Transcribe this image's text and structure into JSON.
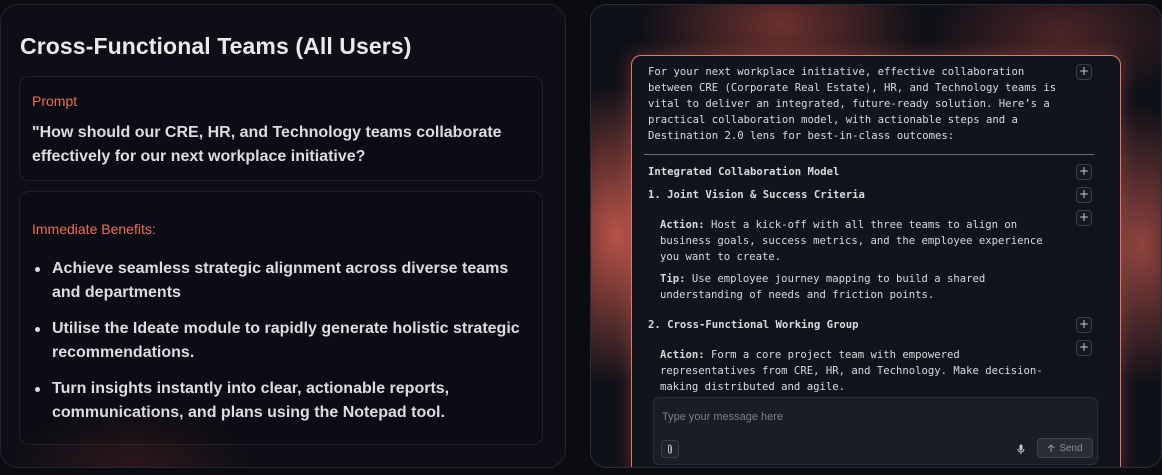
{
  "page": {
    "title": "Cross-Functional Teams (All Users)"
  },
  "prompt_card": {
    "label": "Prompt",
    "text": "\"How should our CRE, HR, and Technology teams collaborate effectively for our next workplace initiative?"
  },
  "benefits_card": {
    "label": "Immediate Benefits:",
    "items": [
      "Achieve seamless strategic alignment across diverse teams and departments",
      "Utilise the Ideate module to rapidly generate holistic strategic recommendations.",
      "Turn insights instantly into clear, actionable reports, communications, and plans using the Notepad tool."
    ]
  },
  "chat": {
    "intro": "For your next workplace initiative, effective collaboration between CRE (Corporate Real Estate), HR, and Technology teams is vital to deliver an integrated, future-ready solution. Here’s a practical collaboration model, with actionable steps and a Destination 2.0 lens for best-in-class outcomes:",
    "section_title": "Integrated Collaboration Model",
    "step1_title": "1. Joint Vision & Success Criteria",
    "step1_action_label": "Action:",
    "step1_action_text": " Host a kick-off with all three teams to align on business goals, success metrics, and the employee experience you want to create.",
    "step1_tip_label": "Tip:",
    "step1_tip_text": " Use employee journey mapping to build a shared understanding of needs and friction points.",
    "step2_title": "2. Cross-Functional Working Group",
    "step2_action_label": "Action:",
    "step2_action_text": " Form a core project team with empowered representatives from CRE, HR, and Technology. Make decision-making distributed and agile.",
    "add_button_label": "+"
  },
  "composer": {
    "placeholder": "Type your message here",
    "send_label": "Send",
    "attach_icon": "paperclip-icon",
    "mic_icon": "microphone-icon",
    "send_icon": "arrow-up-icon"
  },
  "colors": {
    "accent": "#ec6e58",
    "chat_border": "#e6766a",
    "background": "#0b0c12"
  }
}
